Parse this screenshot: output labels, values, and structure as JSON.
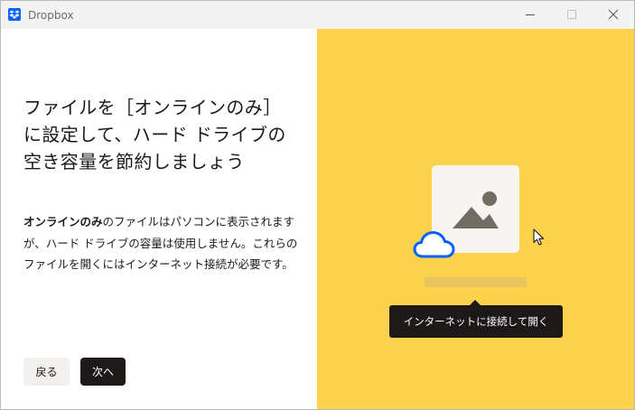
{
  "window": {
    "title": "Dropbox"
  },
  "onboarding": {
    "heading": "ファイルを［オンラインのみ］に設定して、ハード ドライブの空き容量を節約しましょう",
    "body_bold": "オンラインのみ",
    "body_rest": "のファイルはパソコンに表示されますが、ハード ドライブの容量は使用しません。これらのファイルを開くにはインターネット接続が必要です。",
    "back_label": "戻る",
    "next_label": "次へ"
  },
  "illustration": {
    "tooltip": "インターネットに接続して開く",
    "background_color": "#fad24b",
    "cloud_color": "#0061fe",
    "icons": [
      "image-file-icon",
      "cloud-icon",
      "cursor-icon"
    ]
  }
}
